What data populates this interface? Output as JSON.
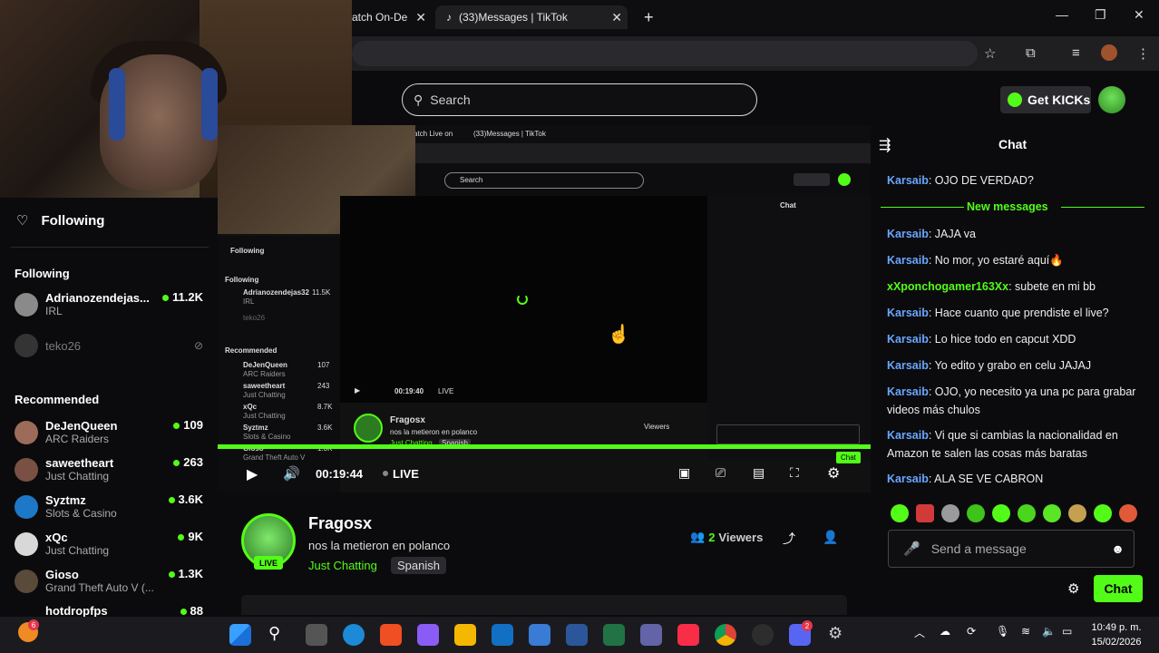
{
  "browser": {
    "tabs": [
      {
        "title": "atch On-De",
        "active": false
      },
      {
        "title": "(33)Messages | TikTok",
        "active": true
      }
    ],
    "new_tab": "+"
  },
  "header": {
    "search_placeholder": "Search",
    "get_kicks": "Get KICKs"
  },
  "sidebar": {
    "following_heading": "Following",
    "following_section": "Following",
    "following": [
      {
        "name": "Adrianozendejas...",
        "sub": "IRL",
        "count": "11.2K",
        "live": true
      },
      {
        "name": "teko26",
        "sub": "",
        "count": "",
        "live": false
      }
    ],
    "recommended_section": "Recommended",
    "recommended": [
      {
        "name": "DeJenQueen",
        "sub": "ARC Raiders",
        "count": "109"
      },
      {
        "name": "saweetheart",
        "sub": "Just Chatting",
        "count": "263"
      },
      {
        "name": "Syztmz",
        "sub": "Slots & Casino",
        "count": "3.6K"
      },
      {
        "name": "xQc",
        "sub": "Just Chatting",
        "count": "9K"
      },
      {
        "name": "Gioso",
        "sub": "Grand Theft Auto V (...",
        "count": "1.3K"
      },
      {
        "name": "hotdropfps",
        "sub": "",
        "count": "88"
      }
    ]
  },
  "nested": {
    "tab1": "atch Live on",
    "tab2": "(33)Messages | TikTok",
    "search": "Search",
    "chat_title": "Chat",
    "following": "Following",
    "following_section": "Following",
    "follow1_name": "Adrianozendejas32",
    "follow1_sub": "IRL",
    "follow1_count": "11.5K",
    "follow2_name": "teko26",
    "recommended": "Recommended",
    "rec": [
      {
        "name": "DeJenQueen",
        "sub": "ARC Raiders",
        "count": "107"
      },
      {
        "name": "saweetheart",
        "sub": "Just Chatting",
        "count": "243"
      },
      {
        "name": "xQc",
        "sub": "Just Chatting",
        "count": "8.7K"
      },
      {
        "name": "Syztmz",
        "sub": "Slots & Casino",
        "count": "3.6K"
      },
      {
        "name": "Gioso",
        "sub": "Grand Theft Auto V",
        "count": "1.3K"
      }
    ],
    "time": "00:19:40",
    "live": "LIVE",
    "channel": "Fragosx",
    "title": "nos la metieron en polanco",
    "category": "Just Chatting",
    "language": "Spanish",
    "viewers": "Viewers",
    "chat_btn": "Chat"
  },
  "player": {
    "time": "00:19:44",
    "live": "LIVE"
  },
  "stream": {
    "channel": "Fragosx",
    "title": "nos la metieron en polanco",
    "category": "Just Chatting",
    "language": "Spanish",
    "viewers_count": "2",
    "viewers_label": "Viewers",
    "live_badge": "LIVE"
  },
  "chat": {
    "title": "Chat",
    "new_messages": "New messages",
    "messages": [
      {
        "user": "Karsaib",
        "text": ": OJO DE VERDAD?",
        "color": "blue"
      },
      {
        "user": "Karsaib",
        "text": ": JAJA va",
        "color": "blue"
      },
      {
        "user": "Karsaib",
        "text": ": No mor, yo estaré aquí🔥",
        "color": "blue"
      },
      {
        "user": "xXponchogamer163Xx",
        "text": ": subete en mi bb",
        "color": "green"
      },
      {
        "user": "Karsaib",
        "text": ": Hace cuanto que prendiste el live?",
        "color": "blue"
      },
      {
        "user": "Karsaib",
        "text": ": Lo hice todo en capcut XDD",
        "color": "blue"
      },
      {
        "user": "Karsaib",
        "text": ": Yo edito y grabo en celu JAJAJ",
        "color": "blue"
      },
      {
        "user": "Karsaib",
        "text": ": OJO, yo necesito ya una pc para grabar videos más chulos",
        "color": "blue"
      },
      {
        "user": "Karsaib",
        "text": ": Vi que si cambias la nacionalidad en Amazon te salen las cosas más baratas",
        "color": "blue"
      },
      {
        "user": "Karsaib",
        "text": ": ALA SE VE CABRON",
        "color": "blue"
      }
    ],
    "input_placeholder": "Send a message",
    "send_label": "Chat"
  },
  "taskbar": {
    "time": "10:49 p. m.",
    "date": "15/02/2026",
    "notification_badge": "6",
    "discord_badge": "2"
  },
  "colors": {
    "kick_green": "#53fc18",
    "username_blue": "#6aa7ff"
  }
}
